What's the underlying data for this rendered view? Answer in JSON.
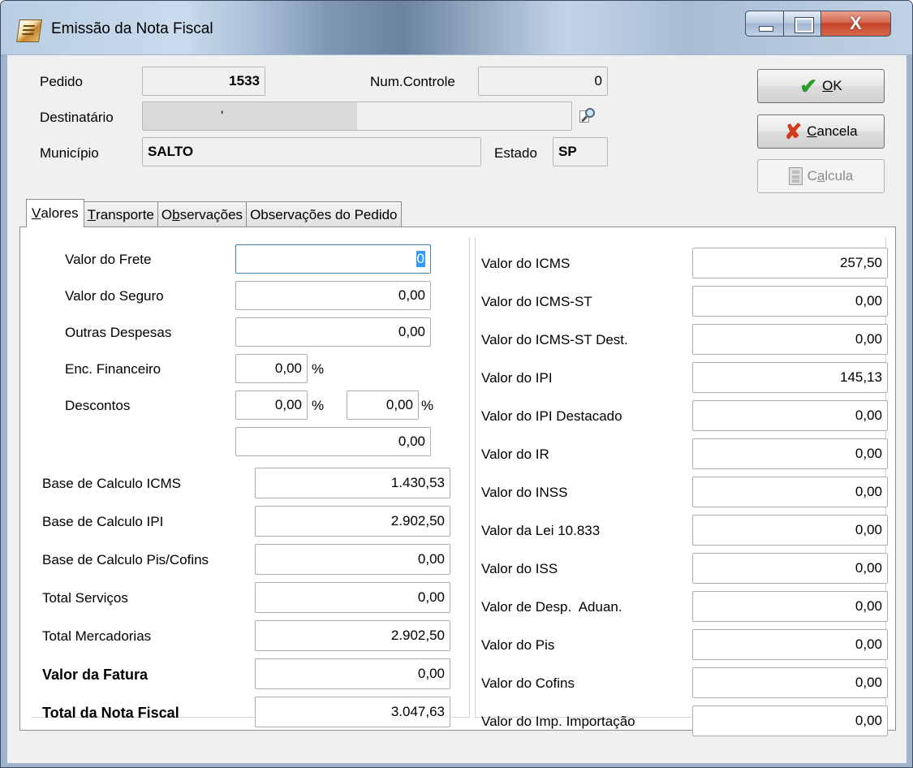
{
  "window": {
    "title": "Emissão da Nota Fiscal",
    "close_glyph": "X"
  },
  "header": {
    "pedido_label": "Pedido",
    "pedido_value": "1533",
    "num_controle_label": "Num.Controle",
    "num_controle_value": "0",
    "destinatario_label": "Destinatário",
    "destinatario_value": "'",
    "municipio_label": "Município",
    "municipio_value": "SALTO",
    "estado_label": "Estado",
    "estado_value": "SP"
  },
  "buttons": {
    "ok": {
      "prefix": "",
      "ul": "O",
      "rest": "K"
    },
    "cancela": {
      "prefix": "",
      "ul": "C",
      "rest": "ancela"
    },
    "calcula": {
      "prefix": "C",
      "ul": "a",
      "rest": "lcula"
    }
  },
  "tabs": [
    {
      "prefix": "",
      "ul": "V",
      "rest": "alores"
    },
    {
      "prefix": "",
      "ul": "T",
      "rest": "ransporte"
    },
    {
      "prefix": "O",
      "ul": "b",
      "rest": "servações"
    },
    {
      "prefix": "",
      "ul": "",
      "rest": "Observações do Pedido"
    }
  ],
  "valores": {
    "frete": {
      "label": "Valor do Frete",
      "value": "0"
    },
    "seguro": {
      "label": "Valor do Seguro",
      "value": "0,00"
    },
    "outras": {
      "label": "Outras Despesas",
      "value": "0,00"
    },
    "encargo": {
      "label": "Enc. Financeiro",
      "value": "0,00",
      "unit": "%"
    },
    "descontos": {
      "label": "Descontos",
      "value1": "0,00",
      "unit1": "%",
      "value2": "0,00",
      "unit2": "%",
      "total": "0,00"
    }
  },
  "bases": [
    {
      "label": "Base de Calculo ICMS",
      "value": "1.430,53",
      "bold": false
    },
    {
      "label": "Base de Calculo IPI",
      "value": "2.902,50",
      "bold": false
    },
    {
      "label": "Base de Calculo Pis/Cofins",
      "value": "0,00",
      "bold": false
    },
    {
      "label": "Total Serviços",
      "value": "0,00",
      "bold": false
    },
    {
      "label": "Total Mercadorias",
      "value": "2.902,50",
      "bold": false
    },
    {
      "label": "Valor da Fatura",
      "value": "0,00",
      "bold": true
    },
    {
      "label": "Total da Nota Fiscal",
      "value": "3.047,63",
      "bold": true
    }
  ],
  "impostos": [
    {
      "label": "Valor do ICMS",
      "value": "257,50"
    },
    {
      "label": "Valor do ICMS-ST",
      "value": "0,00"
    },
    {
      "label": "Valor do ICMS-ST Dest.",
      "value": "0,00"
    },
    {
      "label": "Valor do IPI",
      "value": "145,13"
    },
    {
      "label": "Valor do IPI Destacado",
      "value": "0,00"
    },
    {
      "label": "Valor do IR",
      "value": "0,00"
    },
    {
      "label": "Valor do INSS",
      "value": "0,00"
    },
    {
      "label": "Valor da Lei 10.833",
      "value": "0,00"
    },
    {
      "label": "Valor do ISS",
      "value": "0,00"
    },
    {
      "label": "Valor de Desp.  Aduan.",
      "value": "0,00"
    },
    {
      "label": "Valor do Pis",
      "value": "0,00"
    },
    {
      "label": "Valor do Cofins",
      "value": "0,00"
    },
    {
      "label": "Valor do Imp. Importação",
      "value": "0,00"
    }
  ]
}
